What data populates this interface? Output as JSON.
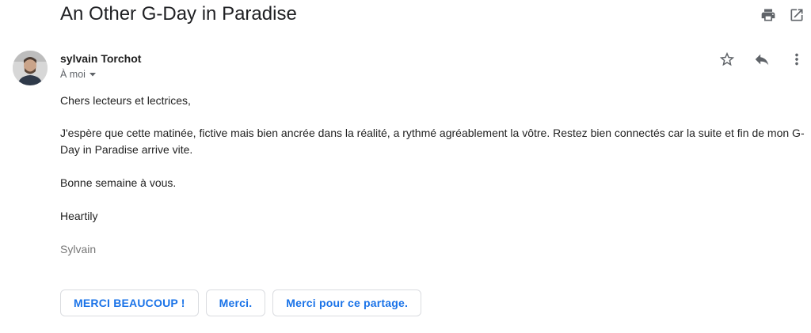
{
  "subject": "An Other G-Day in Paradise",
  "top_actions": [
    {
      "icon": "print-icon",
      "label": "Print"
    },
    {
      "icon": "open-in-new-window-icon",
      "label": "Open in new window"
    }
  ],
  "sender": {
    "name": "sylvain Torchot",
    "to_label": "À moi"
  },
  "message_actions": [
    {
      "icon": "star-icon"
    },
    {
      "icon": "reply-icon"
    },
    {
      "icon": "more-vert-icon"
    }
  ],
  "body": {
    "greeting": "Chers lecteurs et lectrices,",
    "paragraph": "J'espère que cette matinée, fictive mais bien ancrée dans la réalité, a rythmé agréablement la vôtre. Restez bien connectés car la suite et fin de mon G-Day in Paradise arrive vite.",
    "wish": "Bonne semaine à vous.",
    "closing": "Heartily",
    "signature": "Sylvain"
  },
  "quick_replies": [
    "MERCI BEAUCOUP !",
    "Merci.",
    "Merci pour ce partage."
  ],
  "colors": {
    "accent": "#1a73e8",
    "icon": "#5f6368",
    "signature": "#777777"
  }
}
